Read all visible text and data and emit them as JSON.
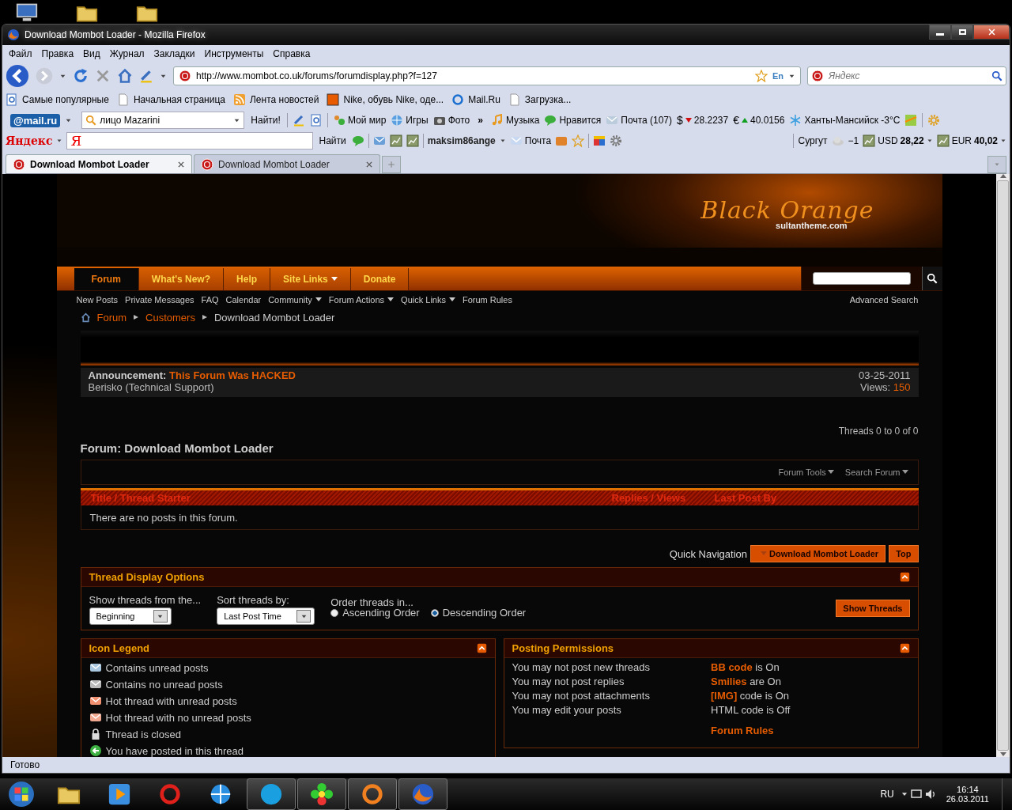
{
  "window": {
    "title": "Download Mombot Loader - Mozilla Firefox"
  },
  "menu": [
    "Файл",
    "Правка",
    "Вид",
    "Журнал",
    "Закладки",
    "Инструменты",
    "Справка"
  ],
  "address_bar": {
    "url": "http://www.mombot.co.uk/forums/forumdisplay.php?f=127",
    "translate_label": "En"
  },
  "search_bar": {
    "placeholder": "Яндекс"
  },
  "bookmarks": [
    "Самые популярные",
    "Начальная страница",
    "Лента новостей",
    "Nike, обувь Nike, оде...",
    "Mail.Ru",
    "Загрузка..."
  ],
  "mail_toolbar": {
    "logo": "@mail.ru",
    "query": "лицо Mazarini",
    "search_button": "Найти!",
    "items": [
      {
        "kind": "link",
        "label": "Мой мир"
      },
      {
        "kind": "link",
        "label": "Игры"
      },
      {
        "kind": "link",
        "label": "Фото"
      },
      {
        "kind": "more",
        "label": "»"
      },
      {
        "kind": "link",
        "label": "Музыка"
      },
      {
        "kind": "link",
        "label": "Нравится"
      },
      {
        "kind": "link",
        "label": "Почта (107)"
      },
      {
        "kind": "rate",
        "sign": "$",
        "rising": false,
        "label": "28.2237"
      },
      {
        "kind": "rate",
        "sign": "€",
        "rising": true,
        "label": "40.0156"
      },
      {
        "kind": "link",
        "label": "Ханты-Мансийск -3°C"
      }
    ]
  },
  "yandex_toolbar": {
    "logo": "Яндекс",
    "field_logo": "Я",
    "search_button": "Найти",
    "user": "maksim86ange",
    "mail": "Почта",
    "city": "Сургут",
    "temperature": "−1",
    "rates": [
      {
        "currency": "USD",
        "value": "28,22"
      },
      {
        "currency": "EUR",
        "value": "40,02"
      }
    ]
  },
  "tabs": [
    {
      "label": "Download Mombot Loader",
      "selected": true
    },
    {
      "label": "Download Mombot Loader",
      "selected": false
    }
  ],
  "forum": {
    "logo": "Black Orange",
    "logo_sub": "sultantheme.com",
    "nav_tabs": [
      {
        "label": "Forum",
        "selected": true,
        "dropdown": false
      },
      {
        "label": "What's New?",
        "selected": false,
        "dropdown": false
      },
      {
        "label": "Help",
        "selected": false,
        "dropdown": false
      },
      {
        "label": "Site Links",
        "selected": false,
        "dropdown": true
      },
      {
        "label": "Donate",
        "selected": false,
        "dropdown": false
      }
    ],
    "subnav": [
      {
        "label": "New Posts",
        "dropdown": false
      },
      {
        "label": "Private Messages",
        "dropdown": false
      },
      {
        "label": "FAQ",
        "dropdown": false
      },
      {
        "label": "Calendar",
        "dropdown": false
      },
      {
        "label": "Community",
        "dropdown": true
      },
      {
        "label": "Forum Actions",
        "dropdown": true
      },
      {
        "label": "Quick Links",
        "dropdown": true
      },
      {
        "label": "Forum Rules",
        "dropdown": false
      }
    ],
    "advanced_search": "Advanced Search",
    "breadcrumb": [
      "Forum",
      "Customers",
      "Download Mombot Loader"
    ],
    "announcement": {
      "label": "Announcement:",
      "title": "This Forum Was HACKED",
      "author": "Berisko (Technical Support)",
      "date": "03-25-2011",
      "views_label": "Views:",
      "views": "150"
    },
    "threads_count": "Threads 0 to 0 of 0",
    "title": "Forum: Download Mombot Loader",
    "tools": [
      "Forum Tools",
      "Search Forum"
    ],
    "columns": [
      "Title / Thread Starter",
      "Replies / Views",
      "Last Post By"
    ],
    "empty_message": "There are no posts in this forum.",
    "quick_nav": {
      "label": "Quick Navigation",
      "button": "Download Mombot Loader",
      "top": "Top"
    },
    "display_options": {
      "title": "Thread Display Options",
      "show_from": {
        "label": "Show threads from the...",
        "value": "Beginning"
      },
      "sort_by": {
        "label": "Sort threads by:",
        "value": "Last Post Time"
      },
      "order": {
        "label": "Order threads in...",
        "options": [
          {
            "label": "Ascending Order",
            "selected": false
          },
          {
            "label": "Descending Order",
            "selected": true
          }
        ]
      },
      "submit": "Show Threads"
    },
    "icon_legend": {
      "title": "Icon Legend",
      "items": [
        "Contains unread posts",
        "Contains no unread posts",
        "Hot thread with unread posts",
        "Hot thread with no unread posts",
        "Thread is closed",
        "You have posted in this thread"
      ]
    },
    "permissions": {
      "title": "Posting Permissions",
      "rules": [
        "You may not post new threads",
        "You may not post replies",
        "You may not post attachments",
        "You may edit your posts"
      ],
      "settings": [
        "**BB code** is On",
        "**Smilies** are On",
        "**[IMG]** code is On",
        "HTML code is Off"
      ],
      "forum_rules": "Forum Rules"
    }
  },
  "status_bar": "Готово",
  "taskbar": {
    "apps": [
      {
        "running": false
      },
      {
        "running": false
      },
      {
        "running": false
      },
      {
        "running": false
      },
      {
        "running": true
      },
      {
        "running": true
      },
      {
        "running": true
      },
      {
        "running": true
      }
    ],
    "lang": "RU",
    "time": "16:14",
    "date": "26.03.2011"
  }
}
